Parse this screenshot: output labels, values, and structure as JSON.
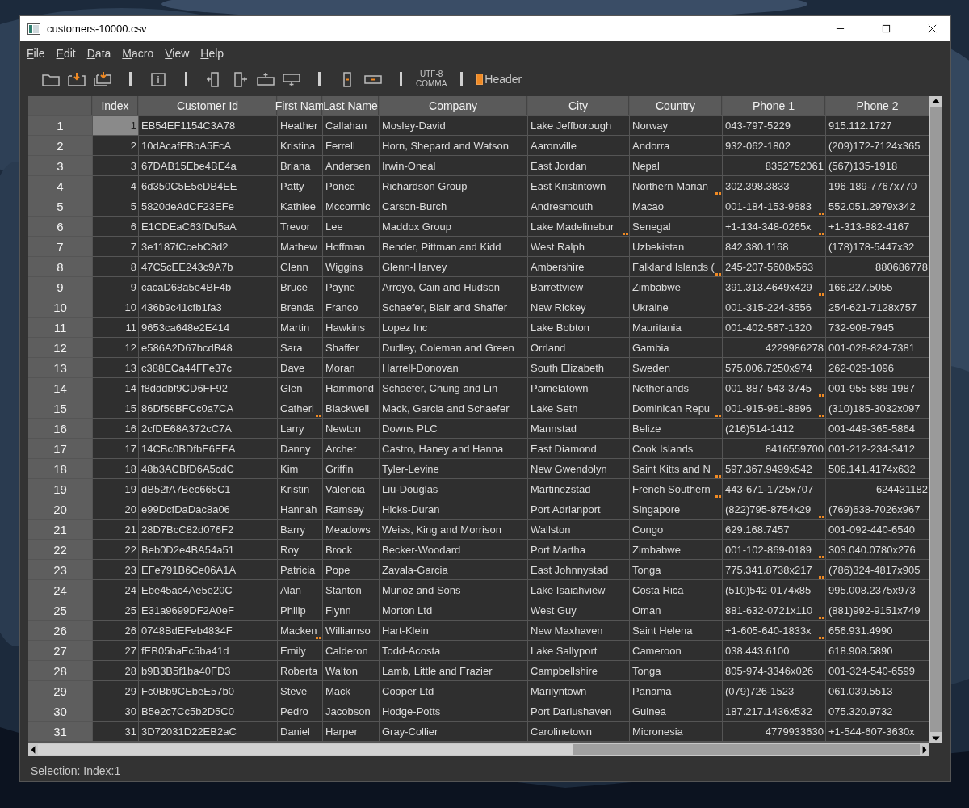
{
  "window": {
    "title": "customers-10000.csv"
  },
  "menu": [
    "File",
    "Edit",
    "Data",
    "Macro",
    "View",
    "Help"
  ],
  "toolbar": {
    "encoding": "UTF-8",
    "delimiter": "COMMA",
    "header": {
      "label": "Header",
      "checked": true
    }
  },
  "table": {
    "columns": [
      {
        "label": "Index"
      },
      {
        "label": "Customer Id"
      },
      {
        "label": "First Nam"
      },
      {
        "label": "Last Name"
      },
      {
        "label": "Company"
      },
      {
        "label": "City"
      },
      {
        "label": "Country"
      },
      {
        "label": "Phone 1"
      },
      {
        "label": "Phone 2"
      }
    ],
    "rows": [
      {
        "number": "1",
        "selected": true,
        "cells": [
          {
            "text": "1",
            "marked": false,
            "kind": "number"
          },
          {
            "text": "EB54EF1154C3A78",
            "marked": false,
            "kind": "text"
          },
          {
            "text": "Heather",
            "marked": false,
            "kind": "text"
          },
          {
            "text": "Callahan",
            "marked": false,
            "kind": "text"
          },
          {
            "text": "Mosley-David",
            "marked": false,
            "kind": "text"
          },
          {
            "text": "Lake Jeffborough",
            "marked": false,
            "kind": "text"
          },
          {
            "text": "Norway",
            "marked": false,
            "kind": "text"
          },
          {
            "text": "043-797-5229",
            "marked": false,
            "kind": "text"
          },
          {
            "text": "915.112.1727",
            "marked": false,
            "kind": "text"
          }
        ]
      },
      {
        "number": "2",
        "selected": false,
        "cells": [
          {
            "text": "2",
            "marked": false,
            "kind": "number"
          },
          {
            "text": "10dAcafEBbA5FcA",
            "marked": false,
            "kind": "text"
          },
          {
            "text": "Kristina",
            "marked": false,
            "kind": "text"
          },
          {
            "text": "Ferrell",
            "marked": false,
            "kind": "text"
          },
          {
            "text": "Horn, Shepard and Watson",
            "marked": false,
            "kind": "text"
          },
          {
            "text": "Aaronville",
            "marked": false,
            "kind": "text"
          },
          {
            "text": "Andorra",
            "marked": false,
            "kind": "text"
          },
          {
            "text": "932-062-1802",
            "marked": false,
            "kind": "text"
          },
          {
            "text": "(209)172-7124x365",
            "marked": false,
            "kind": "text"
          }
        ]
      },
      {
        "number": "3",
        "selected": false,
        "cells": [
          {
            "text": "3",
            "marked": false,
            "kind": "number"
          },
          {
            "text": "67DAB15Ebe4BE4a",
            "marked": false,
            "kind": "text"
          },
          {
            "text": "Briana",
            "marked": false,
            "kind": "text"
          },
          {
            "text": "Andersen",
            "marked": false,
            "kind": "text"
          },
          {
            "text": "Irwin-Oneal",
            "marked": false,
            "kind": "text"
          },
          {
            "text": "East Jordan",
            "marked": false,
            "kind": "text"
          },
          {
            "text": "Nepal",
            "marked": false,
            "kind": "text"
          },
          {
            "text": "8352752061",
            "marked": false,
            "kind": "number"
          },
          {
            "text": "(567)135-1918",
            "marked": false,
            "kind": "text"
          }
        ]
      },
      {
        "number": "4",
        "selected": false,
        "cells": [
          {
            "text": "4",
            "marked": false,
            "kind": "number"
          },
          {
            "text": "6d350C5E5eDB4EE",
            "marked": false,
            "kind": "text"
          },
          {
            "text": "Patty",
            "marked": false,
            "kind": "text"
          },
          {
            "text": "Ponce",
            "marked": false,
            "kind": "text"
          },
          {
            "text": "Richardson Group",
            "marked": false,
            "kind": "text"
          },
          {
            "text": "East Kristintown",
            "marked": false,
            "kind": "text"
          },
          {
            "text": "Northern Marian",
            "marked": true,
            "kind": "text"
          },
          {
            "text": "302.398.3833",
            "marked": false,
            "kind": "text"
          },
          {
            "text": "196-189-7767x770",
            "marked": false,
            "kind": "text"
          }
        ]
      },
      {
        "number": "5",
        "selected": false,
        "cells": [
          {
            "text": "5",
            "marked": false,
            "kind": "number"
          },
          {
            "text": "5820deAdCF23EFe",
            "marked": false,
            "kind": "text"
          },
          {
            "text": "Kathlee",
            "marked": false,
            "kind": "text"
          },
          {
            "text": "Mccormic",
            "marked": false,
            "kind": "text"
          },
          {
            "text": "Carson-Burch",
            "marked": false,
            "kind": "text"
          },
          {
            "text": "Andresmouth",
            "marked": false,
            "kind": "text"
          },
          {
            "text": "Macao",
            "marked": false,
            "kind": "text"
          },
          {
            "text": "001-184-153-9683",
            "marked": true,
            "kind": "text"
          },
          {
            "text": "552.051.2979x342",
            "marked": false,
            "kind": "text"
          }
        ]
      },
      {
        "number": "6",
        "selected": false,
        "cells": [
          {
            "text": "6",
            "marked": false,
            "kind": "number"
          },
          {
            "text": "E1CDEaC63fDd5aA",
            "marked": false,
            "kind": "text"
          },
          {
            "text": "Trevor",
            "marked": false,
            "kind": "text"
          },
          {
            "text": "Lee",
            "marked": false,
            "kind": "text"
          },
          {
            "text": "Maddox Group",
            "marked": false,
            "kind": "text"
          },
          {
            "text": "Lake Madelinebur",
            "marked": true,
            "kind": "text"
          },
          {
            "text": "Senegal",
            "marked": false,
            "kind": "text"
          },
          {
            "text": "+1-134-348-0265x",
            "marked": true,
            "kind": "text"
          },
          {
            "text": "+1-313-882-4167",
            "marked": false,
            "kind": "text"
          }
        ]
      },
      {
        "number": "7",
        "selected": false,
        "cells": [
          {
            "text": "7",
            "marked": false,
            "kind": "number"
          },
          {
            "text": "3e1187fCcebC8d2",
            "marked": false,
            "kind": "text"
          },
          {
            "text": "Mathew",
            "marked": false,
            "kind": "text"
          },
          {
            "text": "Hoffman",
            "marked": false,
            "kind": "text"
          },
          {
            "text": "Bender, Pittman and Kidd",
            "marked": false,
            "kind": "text"
          },
          {
            "text": "West Ralph",
            "marked": false,
            "kind": "text"
          },
          {
            "text": "Uzbekistan",
            "marked": false,
            "kind": "text"
          },
          {
            "text": "842.380.1168",
            "marked": false,
            "kind": "text"
          },
          {
            "text": "(178)178-5447x32",
            "marked": false,
            "kind": "text"
          }
        ]
      },
      {
        "number": "8",
        "selected": false,
        "cells": [
          {
            "text": "8",
            "marked": false,
            "kind": "number"
          },
          {
            "text": "47C5cEE243c9A7b",
            "marked": false,
            "kind": "text"
          },
          {
            "text": "Glenn",
            "marked": false,
            "kind": "text"
          },
          {
            "text": "Wiggins",
            "marked": false,
            "kind": "text"
          },
          {
            "text": "Glenn-Harvey",
            "marked": false,
            "kind": "text"
          },
          {
            "text": "Ambershire",
            "marked": false,
            "kind": "text"
          },
          {
            "text": "Falkland Islands (",
            "marked": true,
            "kind": "text"
          },
          {
            "text": "245-207-5608x563",
            "marked": false,
            "kind": "text"
          },
          {
            "text": "880686778",
            "marked": false,
            "kind": "number"
          }
        ]
      },
      {
        "number": "9",
        "selected": false,
        "cells": [
          {
            "text": "9",
            "marked": false,
            "kind": "number"
          },
          {
            "text": "cacaD68a5e4BF4b",
            "marked": false,
            "kind": "text"
          },
          {
            "text": "Bruce",
            "marked": false,
            "kind": "text"
          },
          {
            "text": "Payne",
            "marked": false,
            "kind": "text"
          },
          {
            "text": "Arroyo, Cain and Hudson",
            "marked": false,
            "kind": "text"
          },
          {
            "text": "Barrettview",
            "marked": false,
            "kind": "text"
          },
          {
            "text": "Zimbabwe",
            "marked": false,
            "kind": "text"
          },
          {
            "text": "391.313.4649x429",
            "marked": true,
            "kind": "text"
          },
          {
            "text": "166.227.5055",
            "marked": false,
            "kind": "text"
          }
        ]
      },
      {
        "number": "10",
        "selected": false,
        "cells": [
          {
            "text": "10",
            "marked": false,
            "kind": "number"
          },
          {
            "text": "436b9c41cfb1fa3",
            "marked": false,
            "kind": "text"
          },
          {
            "text": "Brenda",
            "marked": false,
            "kind": "text"
          },
          {
            "text": "Franco",
            "marked": false,
            "kind": "text"
          },
          {
            "text": "Schaefer, Blair and Shaffer",
            "marked": false,
            "kind": "text"
          },
          {
            "text": "New Rickey",
            "marked": false,
            "kind": "text"
          },
          {
            "text": "Ukraine",
            "marked": false,
            "kind": "text"
          },
          {
            "text": "001-315-224-3556",
            "marked": false,
            "kind": "text"
          },
          {
            "text": "254-621-7128x757",
            "marked": false,
            "kind": "text"
          }
        ]
      },
      {
        "number": "11",
        "selected": false,
        "cells": [
          {
            "text": "11",
            "marked": false,
            "kind": "number"
          },
          {
            "text": "9653ca648e2E414",
            "marked": false,
            "kind": "text"
          },
          {
            "text": "Martin",
            "marked": false,
            "kind": "text"
          },
          {
            "text": "Hawkins",
            "marked": false,
            "kind": "text"
          },
          {
            "text": "Lopez Inc",
            "marked": false,
            "kind": "text"
          },
          {
            "text": "Lake Bobton",
            "marked": false,
            "kind": "text"
          },
          {
            "text": "Mauritania",
            "marked": false,
            "kind": "text"
          },
          {
            "text": "001-402-567-1320",
            "marked": false,
            "kind": "text"
          },
          {
            "text": "732-908-7945",
            "marked": false,
            "kind": "text"
          }
        ]
      },
      {
        "number": "12",
        "selected": false,
        "cells": [
          {
            "text": "12",
            "marked": false,
            "kind": "number"
          },
          {
            "text": "e586A2D67bcdB48",
            "marked": false,
            "kind": "text"
          },
          {
            "text": "Sara",
            "marked": false,
            "kind": "text"
          },
          {
            "text": "Shaffer",
            "marked": false,
            "kind": "text"
          },
          {
            "text": "Dudley, Coleman and Green",
            "marked": false,
            "kind": "text"
          },
          {
            "text": "Orrland",
            "marked": false,
            "kind": "text"
          },
          {
            "text": "Gambia",
            "marked": false,
            "kind": "text"
          },
          {
            "text": "4229986278",
            "marked": false,
            "kind": "number"
          },
          {
            "text": "001-028-824-7381",
            "marked": false,
            "kind": "text"
          }
        ]
      },
      {
        "number": "13",
        "selected": false,
        "cells": [
          {
            "text": "13",
            "marked": false,
            "kind": "number"
          },
          {
            "text": "c388ECa44FFe37c",
            "marked": false,
            "kind": "text"
          },
          {
            "text": "Dave",
            "marked": false,
            "kind": "text"
          },
          {
            "text": "Moran",
            "marked": false,
            "kind": "text"
          },
          {
            "text": "Harrell-Donovan",
            "marked": false,
            "kind": "text"
          },
          {
            "text": "South Elizabeth",
            "marked": false,
            "kind": "text"
          },
          {
            "text": "Sweden",
            "marked": false,
            "kind": "text"
          },
          {
            "text": "575.006.7250x974",
            "marked": false,
            "kind": "text"
          },
          {
            "text": "262-029-1096",
            "marked": false,
            "kind": "text"
          }
        ]
      },
      {
        "number": "14",
        "selected": false,
        "cells": [
          {
            "text": "14",
            "marked": false,
            "kind": "number"
          },
          {
            "text": "f8dddbf9CD6FF92",
            "marked": false,
            "kind": "text"
          },
          {
            "text": "Glen",
            "marked": false,
            "kind": "text"
          },
          {
            "text": "Hammond",
            "marked": false,
            "kind": "text"
          },
          {
            "text": "Schaefer, Chung and Lin",
            "marked": false,
            "kind": "text"
          },
          {
            "text": "Pamelatown",
            "marked": false,
            "kind": "text"
          },
          {
            "text": "Netherlands",
            "marked": false,
            "kind": "text"
          },
          {
            "text": "001-887-543-3745",
            "marked": true,
            "kind": "text"
          },
          {
            "text": "001-955-888-1987",
            "marked": false,
            "kind": "text"
          }
        ]
      },
      {
        "number": "15",
        "selected": false,
        "cells": [
          {
            "text": "15",
            "marked": false,
            "kind": "number"
          },
          {
            "text": "86Df56BFCc0a7CA",
            "marked": false,
            "kind": "text"
          },
          {
            "text": "Catheri",
            "marked": true,
            "kind": "text"
          },
          {
            "text": "Blackwell",
            "marked": false,
            "kind": "text"
          },
          {
            "text": "Mack, Garcia and Schaefer",
            "marked": false,
            "kind": "text"
          },
          {
            "text": "Lake Seth",
            "marked": false,
            "kind": "text"
          },
          {
            "text": "Dominican Repu",
            "marked": true,
            "kind": "text"
          },
          {
            "text": "001-915-961-8896",
            "marked": true,
            "kind": "text"
          },
          {
            "text": "(310)185-3032x097",
            "marked": false,
            "kind": "text"
          }
        ]
      },
      {
        "number": "16",
        "selected": false,
        "cells": [
          {
            "text": "16",
            "marked": false,
            "kind": "number"
          },
          {
            "text": "2cfDE68A372cC7A",
            "marked": false,
            "kind": "text"
          },
          {
            "text": "Larry",
            "marked": false,
            "kind": "text"
          },
          {
            "text": "Newton",
            "marked": false,
            "kind": "text"
          },
          {
            "text": "Downs PLC",
            "marked": false,
            "kind": "text"
          },
          {
            "text": "Mannstad",
            "marked": false,
            "kind": "text"
          },
          {
            "text": "Belize",
            "marked": false,
            "kind": "text"
          },
          {
            "text": "(216)514-1412",
            "marked": false,
            "kind": "text"
          },
          {
            "text": "001-449-365-5864",
            "marked": false,
            "kind": "text"
          }
        ]
      },
      {
        "number": "17",
        "selected": false,
        "cells": [
          {
            "text": "17",
            "marked": false,
            "kind": "number"
          },
          {
            "text": "14CBc0BDfbE6FEA",
            "marked": false,
            "kind": "text"
          },
          {
            "text": "Danny",
            "marked": false,
            "kind": "text"
          },
          {
            "text": "Archer",
            "marked": false,
            "kind": "text"
          },
          {
            "text": "Castro, Haney and Hanna",
            "marked": false,
            "kind": "text"
          },
          {
            "text": "East Diamond",
            "marked": false,
            "kind": "text"
          },
          {
            "text": "Cook Islands",
            "marked": false,
            "kind": "text"
          },
          {
            "text": "8416559700",
            "marked": false,
            "kind": "number"
          },
          {
            "text": "001-212-234-3412",
            "marked": false,
            "kind": "text"
          }
        ]
      },
      {
        "number": "18",
        "selected": false,
        "cells": [
          {
            "text": "18",
            "marked": false,
            "kind": "number"
          },
          {
            "text": "48b3ACBfD6A5cdC",
            "marked": false,
            "kind": "text"
          },
          {
            "text": "Kim",
            "marked": false,
            "kind": "text"
          },
          {
            "text": "Griffin",
            "marked": false,
            "kind": "text"
          },
          {
            "text": "Tyler-Levine",
            "marked": false,
            "kind": "text"
          },
          {
            "text": "New Gwendolyn",
            "marked": false,
            "kind": "text"
          },
          {
            "text": "Saint Kitts and N",
            "marked": true,
            "kind": "text"
          },
          {
            "text": "597.367.9499x542",
            "marked": false,
            "kind": "text"
          },
          {
            "text": "506.141.4174x632",
            "marked": false,
            "kind": "text"
          }
        ]
      },
      {
        "number": "19",
        "selected": false,
        "cells": [
          {
            "text": "19",
            "marked": false,
            "kind": "number"
          },
          {
            "text": "dB52fA7Bec665C1",
            "marked": false,
            "kind": "text"
          },
          {
            "text": "Kristin",
            "marked": false,
            "kind": "text"
          },
          {
            "text": "Valencia",
            "marked": false,
            "kind": "text"
          },
          {
            "text": "Liu-Douglas",
            "marked": false,
            "kind": "text"
          },
          {
            "text": "Martinezstad",
            "marked": false,
            "kind": "text"
          },
          {
            "text": "French Southern",
            "marked": true,
            "kind": "text"
          },
          {
            "text": "443-671-1725x707",
            "marked": false,
            "kind": "text"
          },
          {
            "text": "624431182",
            "marked": false,
            "kind": "number"
          }
        ]
      },
      {
        "number": "20",
        "selected": false,
        "cells": [
          {
            "text": "20",
            "marked": false,
            "kind": "number"
          },
          {
            "text": "e99DcfDaDac8a06",
            "marked": false,
            "kind": "text"
          },
          {
            "text": "Hannah",
            "marked": false,
            "kind": "text"
          },
          {
            "text": "Ramsey",
            "marked": false,
            "kind": "text"
          },
          {
            "text": "Hicks-Duran",
            "marked": false,
            "kind": "text"
          },
          {
            "text": "Port Adrianport",
            "marked": false,
            "kind": "text"
          },
          {
            "text": "Singapore",
            "marked": false,
            "kind": "text"
          },
          {
            "text": "(822)795-8754x29",
            "marked": true,
            "kind": "text"
          },
          {
            "text": "(769)638-7026x967",
            "marked": false,
            "kind": "text"
          }
        ]
      },
      {
        "number": "21",
        "selected": false,
        "cells": [
          {
            "text": "21",
            "marked": false,
            "kind": "number"
          },
          {
            "text": "28D7BcC82d076F2",
            "marked": false,
            "kind": "text"
          },
          {
            "text": "Barry",
            "marked": false,
            "kind": "text"
          },
          {
            "text": "Meadows",
            "marked": false,
            "kind": "text"
          },
          {
            "text": "Weiss, King and Morrison",
            "marked": false,
            "kind": "text"
          },
          {
            "text": "Wallston",
            "marked": false,
            "kind": "text"
          },
          {
            "text": "Congo",
            "marked": false,
            "kind": "text"
          },
          {
            "text": "629.168.7457",
            "marked": false,
            "kind": "text"
          },
          {
            "text": "001-092-440-6540",
            "marked": false,
            "kind": "text"
          }
        ]
      },
      {
        "number": "22",
        "selected": false,
        "cells": [
          {
            "text": "22",
            "marked": false,
            "kind": "number"
          },
          {
            "text": "Beb0D2e4BA54a51",
            "marked": false,
            "kind": "text"
          },
          {
            "text": "Roy",
            "marked": false,
            "kind": "text"
          },
          {
            "text": "Brock",
            "marked": false,
            "kind": "text"
          },
          {
            "text": "Becker-Woodard",
            "marked": false,
            "kind": "text"
          },
          {
            "text": "Port Martha",
            "marked": false,
            "kind": "text"
          },
          {
            "text": "Zimbabwe",
            "marked": false,
            "kind": "text"
          },
          {
            "text": "001-102-869-0189",
            "marked": true,
            "kind": "text"
          },
          {
            "text": "303.040.0780x276",
            "marked": false,
            "kind": "text"
          }
        ]
      },
      {
        "number": "23",
        "selected": false,
        "cells": [
          {
            "text": "23",
            "marked": false,
            "kind": "number"
          },
          {
            "text": "EFe791B6Ce06A1A",
            "marked": false,
            "kind": "text"
          },
          {
            "text": "Patricia",
            "marked": false,
            "kind": "text"
          },
          {
            "text": "Pope",
            "marked": false,
            "kind": "text"
          },
          {
            "text": "Zavala-Garcia",
            "marked": false,
            "kind": "text"
          },
          {
            "text": "East Johnnystad",
            "marked": false,
            "kind": "text"
          },
          {
            "text": "Tonga",
            "marked": false,
            "kind": "text"
          },
          {
            "text": "775.341.8738x217",
            "marked": true,
            "kind": "text"
          },
          {
            "text": "(786)324-4817x905",
            "marked": false,
            "kind": "text"
          }
        ]
      },
      {
        "number": "24",
        "selected": false,
        "cells": [
          {
            "text": "24",
            "marked": false,
            "kind": "number"
          },
          {
            "text": "Ebe45ac4Ae5e20C",
            "marked": false,
            "kind": "text"
          },
          {
            "text": "Alan",
            "marked": false,
            "kind": "text"
          },
          {
            "text": "Stanton",
            "marked": false,
            "kind": "text"
          },
          {
            "text": "Munoz and Sons",
            "marked": false,
            "kind": "text"
          },
          {
            "text": "Lake Isaiahview",
            "marked": false,
            "kind": "text"
          },
          {
            "text": "Costa Rica",
            "marked": false,
            "kind": "text"
          },
          {
            "text": "(510)542-0174x85",
            "marked": false,
            "kind": "text"
          },
          {
            "text": "995.008.2375x973",
            "marked": false,
            "kind": "text"
          }
        ]
      },
      {
        "number": "25",
        "selected": false,
        "cells": [
          {
            "text": "25",
            "marked": false,
            "kind": "number"
          },
          {
            "text": "E31a9699DF2A0eF",
            "marked": false,
            "kind": "text"
          },
          {
            "text": "Philip",
            "marked": false,
            "kind": "text"
          },
          {
            "text": "Flynn",
            "marked": false,
            "kind": "text"
          },
          {
            "text": "Morton Ltd",
            "marked": false,
            "kind": "text"
          },
          {
            "text": "West Guy",
            "marked": false,
            "kind": "text"
          },
          {
            "text": "Oman",
            "marked": false,
            "kind": "text"
          },
          {
            "text": "881-632-0721x110",
            "marked": true,
            "kind": "text"
          },
          {
            "text": "(881)992-9151x749",
            "marked": false,
            "kind": "text"
          }
        ]
      },
      {
        "number": "26",
        "selected": false,
        "cells": [
          {
            "text": "26",
            "marked": false,
            "kind": "number"
          },
          {
            "text": "0748BdEFeb4834F",
            "marked": false,
            "kind": "text"
          },
          {
            "text": "Macken",
            "marked": true,
            "kind": "text"
          },
          {
            "text": "Williamso",
            "marked": false,
            "kind": "text"
          },
          {
            "text": "Hart-Klein",
            "marked": false,
            "kind": "text"
          },
          {
            "text": "New Maxhaven",
            "marked": false,
            "kind": "text"
          },
          {
            "text": "Saint Helena",
            "marked": false,
            "kind": "text"
          },
          {
            "text": "+1-605-640-1833x",
            "marked": true,
            "kind": "text"
          },
          {
            "text": "656.931.4990",
            "marked": false,
            "kind": "text"
          }
        ]
      },
      {
        "number": "27",
        "selected": false,
        "cells": [
          {
            "text": "27",
            "marked": false,
            "kind": "number"
          },
          {
            "text": "fEB05baEc5ba41d",
            "marked": false,
            "kind": "text"
          },
          {
            "text": "Emily",
            "marked": false,
            "kind": "text"
          },
          {
            "text": "Calderon",
            "marked": false,
            "kind": "text"
          },
          {
            "text": "Todd-Acosta",
            "marked": false,
            "kind": "text"
          },
          {
            "text": "Lake Sallyport",
            "marked": false,
            "kind": "text"
          },
          {
            "text": "Cameroon",
            "marked": false,
            "kind": "text"
          },
          {
            "text": "038.443.6100",
            "marked": false,
            "kind": "text"
          },
          {
            "text": "618.908.5890",
            "marked": false,
            "kind": "text"
          }
        ]
      },
      {
        "number": "28",
        "selected": false,
        "cells": [
          {
            "text": "28",
            "marked": false,
            "kind": "number"
          },
          {
            "text": "b9B3B5f1ba40FD3",
            "marked": false,
            "kind": "text"
          },
          {
            "text": "Roberta",
            "marked": false,
            "kind": "text"
          },
          {
            "text": "Walton",
            "marked": false,
            "kind": "text"
          },
          {
            "text": "Lamb, Little and Frazier",
            "marked": false,
            "kind": "text"
          },
          {
            "text": "Campbellshire",
            "marked": false,
            "kind": "text"
          },
          {
            "text": "Tonga",
            "marked": false,
            "kind": "text"
          },
          {
            "text": "805-974-3346x026",
            "marked": false,
            "kind": "text"
          },
          {
            "text": "001-324-540-6599",
            "marked": false,
            "kind": "text"
          }
        ]
      },
      {
        "number": "29",
        "selected": false,
        "cells": [
          {
            "text": "29",
            "marked": false,
            "kind": "number"
          },
          {
            "text": "Fc0Bb9CEbeE57b0",
            "marked": false,
            "kind": "text"
          },
          {
            "text": "Steve",
            "marked": false,
            "kind": "text"
          },
          {
            "text": "Mack",
            "marked": false,
            "kind": "text"
          },
          {
            "text": "Cooper Ltd",
            "marked": false,
            "kind": "text"
          },
          {
            "text": "Marilyntown",
            "marked": false,
            "kind": "text"
          },
          {
            "text": "Panama",
            "marked": false,
            "kind": "text"
          },
          {
            "text": "(079)726-1523",
            "marked": false,
            "kind": "text"
          },
          {
            "text": "061.039.5513",
            "marked": false,
            "kind": "text"
          }
        ]
      },
      {
        "number": "30",
        "selected": false,
        "cells": [
          {
            "text": "30",
            "marked": false,
            "kind": "number"
          },
          {
            "text": "B5e2c7Cc5b2D5C0",
            "marked": false,
            "kind": "text"
          },
          {
            "text": "Pedro",
            "marked": false,
            "kind": "text"
          },
          {
            "text": "Jacobson",
            "marked": false,
            "kind": "text"
          },
          {
            "text": "Hodge-Potts",
            "marked": false,
            "kind": "text"
          },
          {
            "text": "Port Dariushaven",
            "marked": false,
            "kind": "text"
          },
          {
            "text": "Guinea",
            "marked": false,
            "kind": "text"
          },
          {
            "text": "187.217.1436x532",
            "marked": false,
            "kind": "text"
          },
          {
            "text": "075.320.9732",
            "marked": false,
            "kind": "text"
          }
        ]
      },
      {
        "number": "31",
        "selected": false,
        "cells": [
          {
            "text": "31",
            "marked": false,
            "kind": "number"
          },
          {
            "text": "3D72031D22EB2aC",
            "marked": false,
            "kind": "text"
          },
          {
            "text": "Daniel",
            "marked": false,
            "kind": "text"
          },
          {
            "text": "Harper",
            "marked": false,
            "kind": "text"
          },
          {
            "text": "Gray-Collier",
            "marked": false,
            "kind": "text"
          },
          {
            "text": "Carolinetown",
            "marked": false,
            "kind": "text"
          },
          {
            "text": "Micronesia",
            "marked": false,
            "kind": "text"
          },
          {
            "text": "4779933630",
            "marked": false,
            "kind": "number"
          },
          {
            "text": "+1-544-607-3630x",
            "marked": false,
            "kind": "text"
          }
        ]
      }
    ]
  },
  "status_bar": "Selection: Index:1"
}
